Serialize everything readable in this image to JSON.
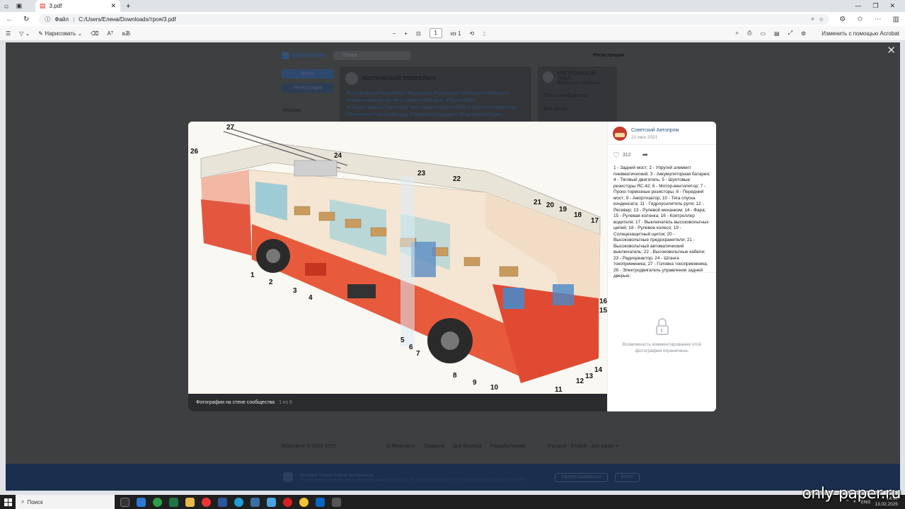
{
  "browser": {
    "tab_title": "3.pdf",
    "url_prefix": "Файл",
    "url": "C:/Users/Елена/Downloads/троя/3.pdf"
  },
  "pdf_toolbar": {
    "draw_label": "Нарисовать",
    "page_current": "1",
    "page_total": "из 1",
    "acrobat_label": "Изменить с помощью Acrobat"
  },
  "vk_background": {
    "logo_text": "вконтакте",
    "search_placeholder": "Поиск",
    "register_link": "Регистрация",
    "login_button": "Войти",
    "signup_button": "Регистрация",
    "music_label": "Музыка",
    "group_name": "КОСТРОМСКОЙ ТРОЛЛЕЙБУС",
    "hashtags": "#КостромскойТроллейбус #Кострома #Транспорт #Регион44 #Новости #НовостиКостромы #КостромскаяОбласть #Троллейбус #ОбщественныйТранспорт #КостромаНаТроллейбусе #Электротранспорт #Экология #ЧистыйВоздух #ТранспортБудущего #ГорЭлектроТранс",
    "side_group_name": "КОСТРОМСКОЙ ТРОЛ...",
    "side_group_sub": "Вернуться к странице",
    "side_posts": "Посты сообщества",
    "side_all_posts": "Все посты",
    "footer_copy": "ВКонтакте © 2006-2025",
    "footer_links": [
      "О ВКонтакте",
      "Правила",
      "Для бизнеса",
      "Разработчикам"
    ],
    "footer_langs": "Русский · English · все языки »",
    "banner_title": "Читайте только самое интересное",
    "banner_text": "Мы подбираем записи в ленте на основе ваших интересов. Это персональная лента — зарегистрируйтесь и всё получится.",
    "banner_register": "Зарегистрироваться",
    "banner_login": "Войти"
  },
  "photo": {
    "footer_label": "Фотографии на стене сообщества",
    "footer_count": "1 из 6",
    "labels": [
      "1",
      "2",
      "3",
      "4",
      "5",
      "6",
      "7",
      "8",
      "9",
      "10",
      "11",
      "12",
      "13",
      "14",
      "15",
      "16",
      "17",
      "18",
      "19",
      "20",
      "21",
      "22",
      "23",
      "24",
      "26",
      "27"
    ]
  },
  "post": {
    "author": "Советский Автопром",
    "date": "21 июн 2021",
    "likes": "312",
    "description": "1 - Задний мост; 2 - Упругий элемент пневматический; 3 - Аккумуляторная батарея; 4 - Тяговый двигатель; 5 - Шунтовые резисторы ЯС-42; 6 - Мотор-вентилятор; 7 - Пуско-тормозные резисторы; 8 - Передний мост; 9 - Амортизатор; 10 - Тяга спуска конденсата; 11 - Гидроусилитель руля; 12 - Ресивер; 13 - Рулевой механизм; 14 - Фара; 15 - Рулевая колонка; 16 - Контроллер водителя; 17 - Выключатель высоковольтных цепей; 18 - Рулевое колесо; 19 - Солнцезащитный щиток; 20 - Высоковольтные предохранители; 21 - Высоковольтный автоматический выключатель; 22 - Высоковольтные кабели; 23 - Радиореактор; 24 - Штанга токоприемника; 27 - Головка токоприемника; 26 - Электродвигатель управления задней дверью;",
    "comments_disabled": "Возможность комментирования этой фотографии ограничена."
  },
  "taskbar": {
    "search_label": "Поиск",
    "lang": "ENG",
    "time": "14:12",
    "date": "13.02.2025"
  },
  "watermark": "only-paper.ru"
}
